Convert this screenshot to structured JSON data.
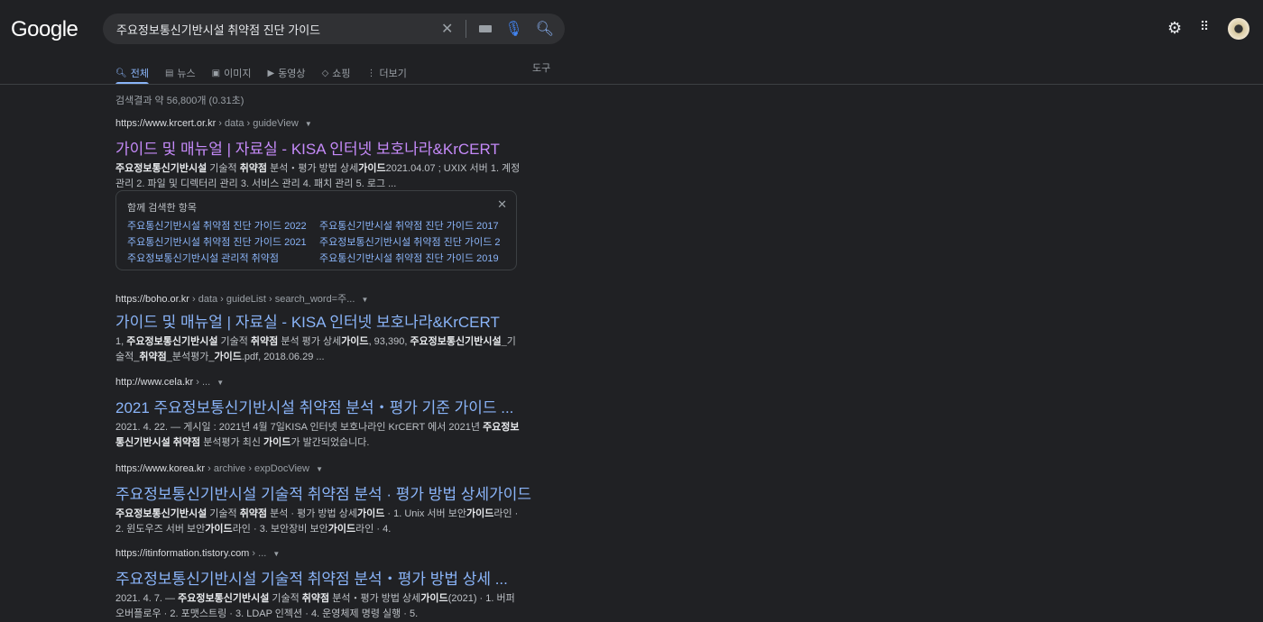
{
  "logo": "Google",
  "search": {
    "query": "주요정보통신기반시설 취약점 진단 가이드"
  },
  "tabs": [
    {
      "label": "전체",
      "icon": "search-icon"
    },
    {
      "label": "뉴스",
      "icon": "news-icon"
    },
    {
      "label": "이미지",
      "icon": "image-icon"
    },
    {
      "label": "동영상",
      "icon": "video-icon"
    },
    {
      "label": "쇼핑",
      "icon": "tag-icon"
    },
    {
      "label": "더보기",
      "icon": "more-icon"
    }
  ],
  "tools": "도구",
  "stats": "검색결과 약 56,800개 (0.31초)",
  "results": [
    {
      "domain": "https://www.krcert.or.kr",
      "path": " › data › guideView",
      "title": "가이드 및 매뉴얼 | 자료실 - KISA 인터넷 보호나라&KrCERT",
      "visited": true,
      "snippet": [
        {
          "t": "주요정보통신기반시설",
          "b": true
        },
        {
          "t": " 기술적 "
        },
        {
          "t": "취약점",
          "b": true
        },
        {
          "t": " 분석・평가 방법 상세"
        },
        {
          "t": "가이드",
          "b": true
        },
        {
          "t": "2021.04.07 ; UXIX 서버 1. 계정 관리 2. 파일 및 디렉터리 관리 3. 서비스 관리 4. 패치 관리 5. 로그 ..."
        }
      ]
    },
    {
      "domain": "https://boho.or.kr",
      "path": " › data › guideList › search_word=주...",
      "title": "가이드 및 매뉴얼 | 자료실 - KISA 인터넷 보호나라&KrCERT",
      "snippet": [
        {
          "t": "1, "
        },
        {
          "t": "주요정보통신기반시설",
          "b": true
        },
        {
          "t": " 기술적 "
        },
        {
          "t": "취약점",
          "b": true
        },
        {
          "t": " 분석 평가 상세"
        },
        {
          "t": "가이드",
          "b": true
        },
        {
          "t": ", 93,390, "
        },
        {
          "t": "주요정보통신기반시설_",
          "b": true
        },
        {
          "t": "기술적_"
        },
        {
          "t": "취약점",
          "b": true
        },
        {
          "t": "_분석평가_"
        },
        {
          "t": "가이드",
          "b": true
        },
        {
          "t": ".pdf, 2018.06.29 ..."
        }
      ]
    },
    {
      "domain": "http://www.cela.kr",
      "path": " › ...",
      "title": "2021 주요정보통신기반시설 취약점 분석・평가 기준 가이드 ...",
      "snippet": [
        {
          "t": "2021. 4. 22. — 게시일 : 2021년 4월 7일KISA 인터넷 보호나라인 KrCERT 에서 2021년 "
        },
        {
          "t": "주요정보통신기반시설 취약점",
          "b": true
        },
        {
          "t": " 분석평가 최신 "
        },
        {
          "t": "가이드",
          "b": true
        },
        {
          "t": "가 발간되었습니다."
        }
      ]
    },
    {
      "domain": "https://www.korea.kr",
      "path": " › archive › expDocView",
      "title": "주요정보통신기반시설 기술적 취약점 분석 · 평가 방법 상세가이드",
      "snippet": [
        {
          "t": "주요정보통신기반시설",
          "b": true
        },
        {
          "t": " 기술적 "
        },
        {
          "t": "취약점",
          "b": true
        },
        {
          "t": " 분석 · 평가 방법 상세"
        },
        {
          "t": "가이드",
          "b": true
        },
        {
          "t": " · 1. Unix 서버 보안"
        },
        {
          "t": "가이드",
          "b": true
        },
        {
          "t": "라인 · 2. 윈도우즈 서버 보안"
        },
        {
          "t": "가이드",
          "b": true
        },
        {
          "t": "라인 · 3. 보안장비 보안"
        },
        {
          "t": "가이드",
          "b": true
        },
        {
          "t": "라인 · 4."
        }
      ]
    },
    {
      "domain": "https://itinformation.tistory.com",
      "path": " › ...",
      "title": "주요정보통신기반시설 기술적 취약점 분석・평가 방법 상세 ...",
      "snippet": [
        {
          "t": "2021. 4. 7. — "
        },
        {
          "t": "주요정보통신기반시설",
          "b": true
        },
        {
          "t": " 기술적 "
        },
        {
          "t": "취약점",
          "b": true
        },
        {
          "t": " 분석・평가 방법 상세"
        },
        {
          "t": "가이드",
          "b": true
        },
        {
          "t": "(2021) · 1. 버퍼 오버플로우 · 2. 포맷스트링 · 3. LDAP 인젝션 · 4. 운영체제 명령 실행 · 5."
        }
      ]
    }
  ],
  "related": {
    "heading": "함께 검색한 항목",
    "items": [
      "주요통신기반시설 취약점 진단 가이드 2022",
      "주요통신기반시설 취약점 진단 가이드 2017",
      "주요통신기반시설 취약점 진단 가이드 2021",
      "주요정보통신기반시설 취약점 진단 가이드 2",
      "주요정보통신기반시설 관리적 취약점",
      "주요통신기반시설 취약점 진단 가이드 2019"
    ]
  }
}
